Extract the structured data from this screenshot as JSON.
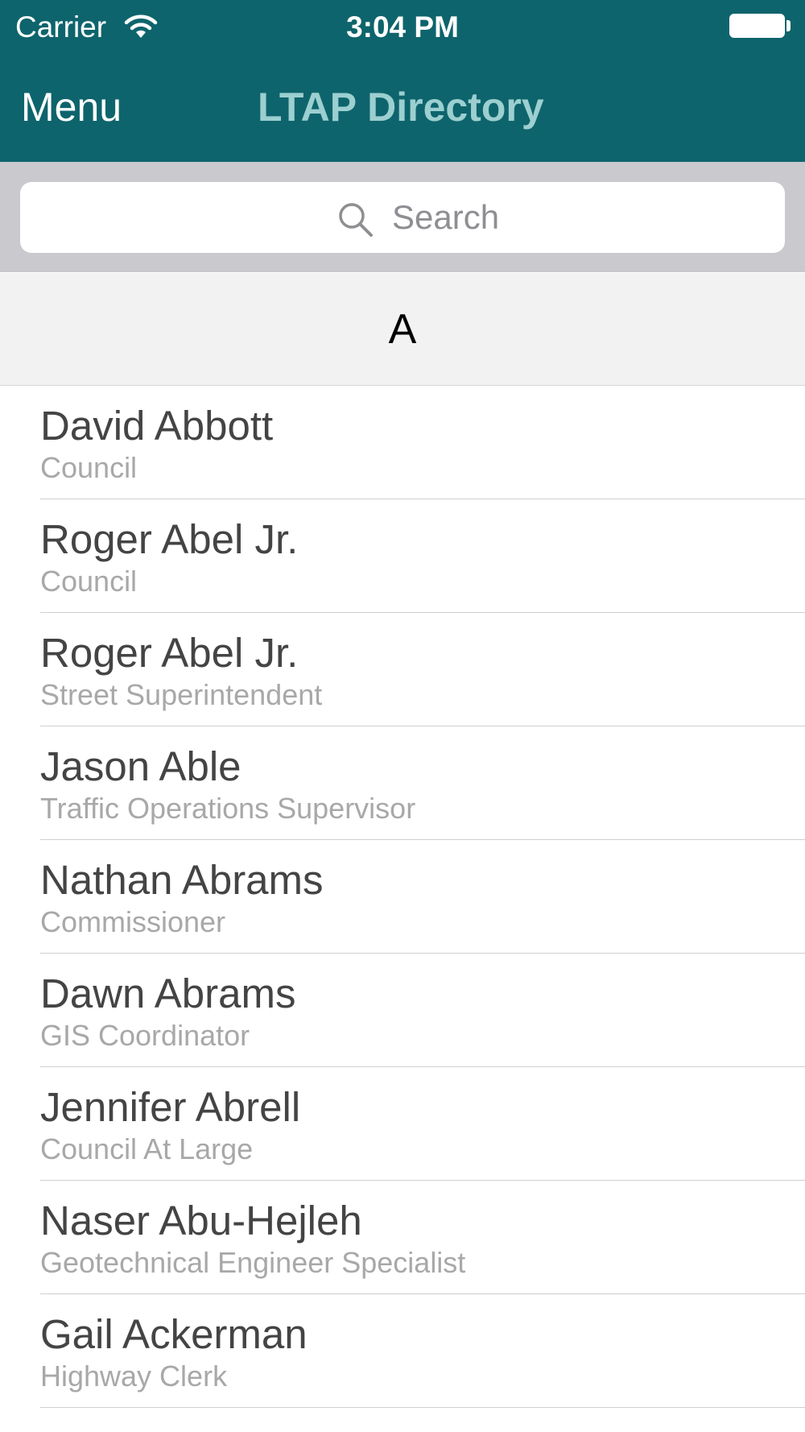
{
  "status_bar": {
    "carrier": "Carrier",
    "time": "3:04 PM",
    "wifi_icon": "wifi-icon",
    "battery_icon": "battery-icon"
  },
  "nav": {
    "menu_label": "Menu",
    "title": "LTAP Directory"
  },
  "search": {
    "placeholder": "Search",
    "icon": "search-icon"
  },
  "colors": {
    "nav_background": "#0e646c",
    "nav_title": "#9ccfd0",
    "search_background": "#c9c9ce",
    "section_background": "#f2f2f2"
  },
  "directory": {
    "section_letter": "A",
    "contacts": [
      {
        "name": "David Abbott",
        "title": "Council"
      },
      {
        "name": "Roger Abel Jr.",
        "title": "Council"
      },
      {
        "name": "Roger Abel Jr.",
        "title": "Street Superintendent"
      },
      {
        "name": "Jason Able",
        "title": "Traffic Operations Supervisor"
      },
      {
        "name": "Nathan Abrams",
        "title": "Commissioner"
      },
      {
        "name": "Dawn Abrams",
        "title": "GIS Coordinator"
      },
      {
        "name": "Jennifer Abrell",
        "title": "Council At Large"
      },
      {
        "name": "Naser Abu-Hejleh",
        "title": "Geotechnical Engineer Specialist"
      },
      {
        "name": "Gail Ackerman",
        "title": "Highway Clerk"
      }
    ]
  }
}
